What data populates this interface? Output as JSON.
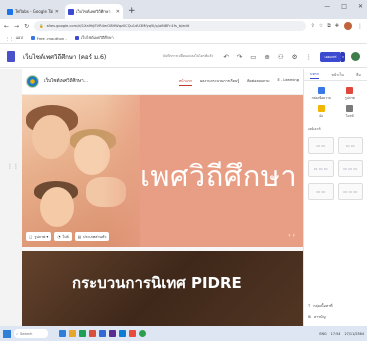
{
  "browser": {
    "tabs": [
      {
        "label": "Teflabs - Google Tab",
        "favicon_color": "#1a73e8",
        "active": false
      },
      {
        "label": "เว็บไซต์เพศวิถีศึกษา",
        "favicon_color": "#3b4ad0",
        "active": true
      }
    ],
    "new_tab": "+",
    "window_controls": [
      "—",
      "□",
      "✕"
    ],
    "address": "sites.google.com/d/1Xa9hJEVR4mO8HWqz0CQu1dU3Mfyq5l/p/alN8Fn1fs_b/edit",
    "bookmarks": [
      {
        "label": "แอป"
      },
      {
        "label": "Free .mouthon -"
      },
      {
        "label": "เว็บไซต์เพศวิถีศึกษา"
      }
    ]
  },
  "editor": {
    "title": "เว็บไซต์เพศวิถีศึกษา (คอร์ ม.6)",
    "draft_status": "บันทึกการเปลี่ยนแปลงในไดรฟ์แล้ว",
    "tools": [
      "↶",
      "↷",
      "▭",
      "⊕",
      "⚇",
      "⚙",
      "⋮"
    ],
    "publish_label": "เผยแพร่",
    "publish_dropdown": "▾"
  },
  "site": {
    "name": "เว็บไซต์เพศวิถีศึกษา...",
    "nav_links": [
      {
        "label": "หน้าแรก",
        "active": true
      },
      {
        "label": "ผลงานกระบวนการเรียนรู้",
        "active": false
      },
      {
        "label": "ติดต่อสอบถาม",
        "active": false
      },
      {
        "label": "E - Learning",
        "active": false
      }
    ],
    "hero_title": "เพศวิถีศึกษา",
    "hero_tools": [
      {
        "icon": "▢",
        "label": "รูปภาพ ▾"
      },
      {
        "icon": "◔",
        "label": "ไปล์"
      },
      {
        "icon": "▤",
        "label": "ประเภทส่วนหัว"
      }
    ],
    "hero_arrows": "‹ ›",
    "section2_title": "กระบวนการนิเทศ PIDRE"
  },
  "panel": {
    "tabs": [
      {
        "label": "แทรก",
        "active": true
      },
      {
        "label": "หน้าเว็บ",
        "active": false
      },
      {
        "label": "ธีม",
        "active": false
      }
    ],
    "insert_items": [
      {
        "label": "กล่องข้อความ",
        "color": "#3b78e7"
      },
      {
        "label": "รูปภาพ",
        "color": "#e0483e"
      },
      {
        "label": "ฝัง",
        "color": "#f2b600"
      },
      {
        "label": "ไดรฟ์",
        "color": "#7a7a7a"
      }
    ],
    "layouts_label": "เลย์เอาต์",
    "layouts": [
      "▭ ▭",
      "▭ ▭",
      "▭ ▭ ▭",
      "▭ ▭ ▭",
      "▭ ▭",
      "▭ ▭ ▭"
    ],
    "footer": [
      {
        "icon": "T",
        "label": "กลุ่มเนื้อหาที่"
      },
      {
        "icon": "⊞",
        "label": "สารบัญ"
      }
    ]
  },
  "taskbar": {
    "search_placeholder": "Search",
    "apps": [
      "#2f7fd6",
      "#e6a52b",
      "#1f9e55",
      "#d94f3b",
      "#3367d6",
      "#5c2d91",
      "#0e7bd4",
      "#e74c3c",
      "#2d9e4d"
    ],
    "tray": [
      "ENG",
      "17:54",
      "27/11/2564"
    ]
  }
}
